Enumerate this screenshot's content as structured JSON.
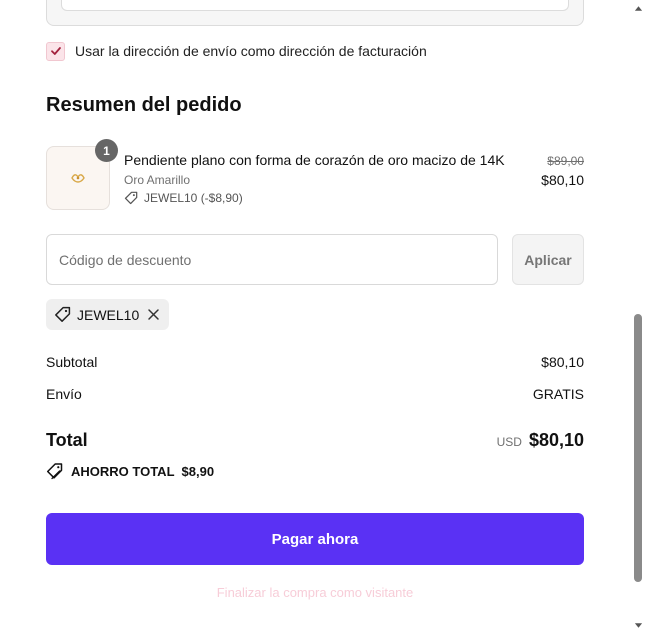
{
  "billing": {
    "checked": true,
    "label": "Usar la dirección de envío como dirección de facturación"
  },
  "summary": {
    "title": "Resumen del pedido",
    "product": {
      "quantity": "1",
      "name": "Pendiente plano con forma de corazón de oro macizo de 14K",
      "variant": "Oro Amarillo",
      "discount": "JEWEL10 (-$8,90)",
      "original_price": "$89,00",
      "price": "$80,10"
    }
  },
  "discount_code": {
    "placeholder": "Código de descuento",
    "value": "",
    "apply_label": "Aplicar",
    "applied_code": "JEWEL10"
  },
  "totals": {
    "subtotal_label": "Subtotal",
    "subtotal_value": "$80,10",
    "shipping_label": "Envío",
    "shipping_value": "GRATIS",
    "total_label": "Total",
    "currency": "USD",
    "total_value": "$80,10",
    "savings_label": "AHORRO TOTAL",
    "savings_value": "$8,90"
  },
  "actions": {
    "pay_label": "Pagar ahora",
    "guest_label": "Finalizar la compra como visitante"
  },
  "colors": {
    "pay_button": "#5a31f4",
    "checkbox_bg": "#fbe4e9",
    "guest_link": "#f7cdd8"
  },
  "icons": {
    "checkbox": "check-icon",
    "discount_tag": "tag-icon",
    "remove": "close-icon",
    "savings": "tags-icon",
    "scroll_up": "triangle-up-icon",
    "scroll_down": "triangle-down-icon"
  }
}
